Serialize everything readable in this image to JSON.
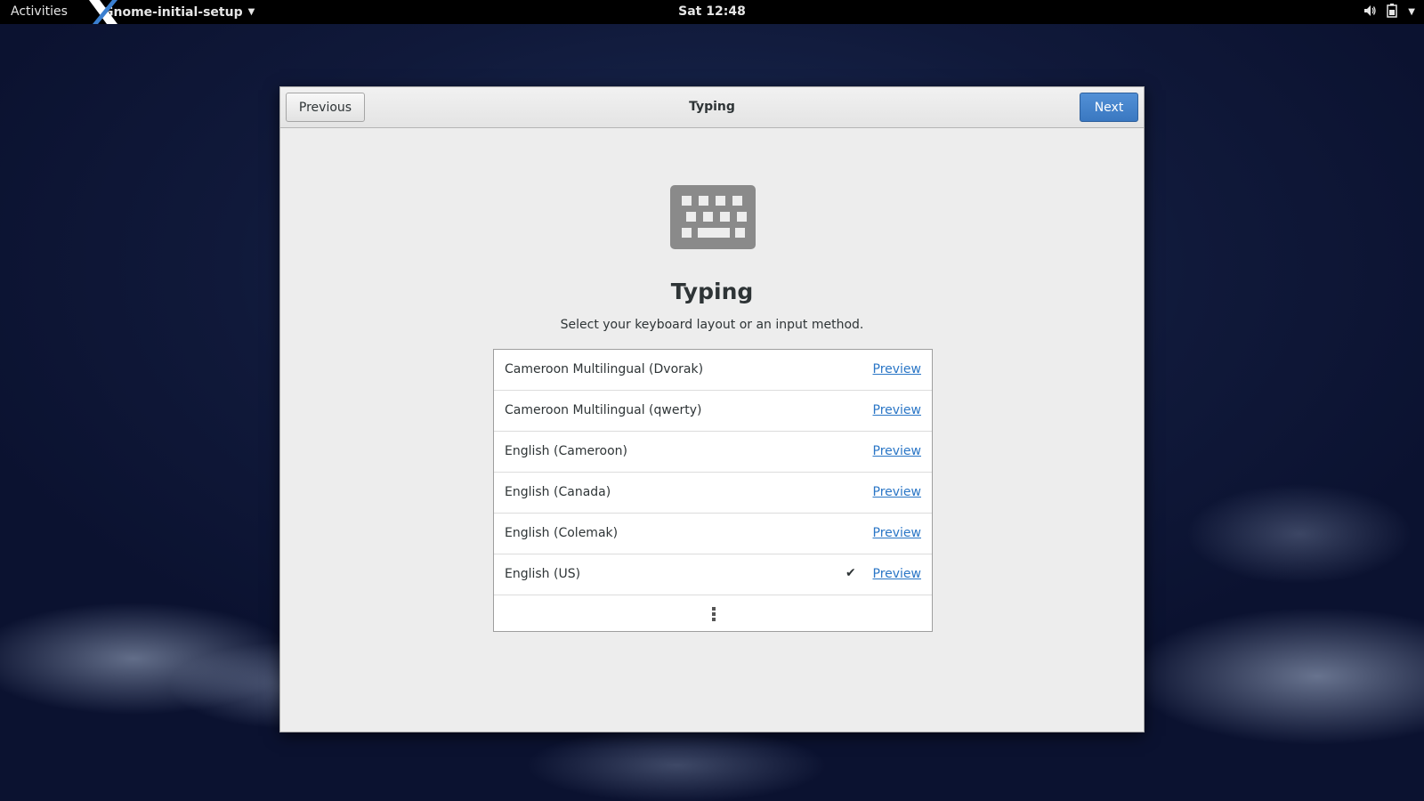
{
  "topbar": {
    "activities": "Activities",
    "app_name": "Gnome-initial-setup",
    "clock": "Sat 12:48",
    "tray_icons": [
      "speaker-icon",
      "battery-icon",
      "chevron-down-icon"
    ]
  },
  "dialog": {
    "title": "Typing",
    "previous_label": "Previous",
    "next_label": "Next",
    "icon": "keyboard-icon",
    "heading": "Typing",
    "subtitle": "Select your keyboard layout or an input method.",
    "layouts": [
      {
        "name": "Cameroon Multilingual (Dvorak)",
        "preview": "Preview",
        "selected": false
      },
      {
        "name": "Cameroon Multilingual (qwerty)",
        "preview": "Preview",
        "selected": false
      },
      {
        "name": "English (Cameroon)",
        "preview": "Preview",
        "selected": false
      },
      {
        "name": "English (Canada)",
        "preview": "Preview",
        "selected": false
      },
      {
        "name": "English (Colemak)",
        "preview": "Preview",
        "selected": false
      },
      {
        "name": "English (US)",
        "preview": "Preview",
        "selected": true
      }
    ],
    "more_icon": "view-more-icon"
  },
  "colors": {
    "accent": "#3a78c1",
    "link": "#2a76c6",
    "topbar": "#000000",
    "dialog_bg": "#ededed"
  }
}
